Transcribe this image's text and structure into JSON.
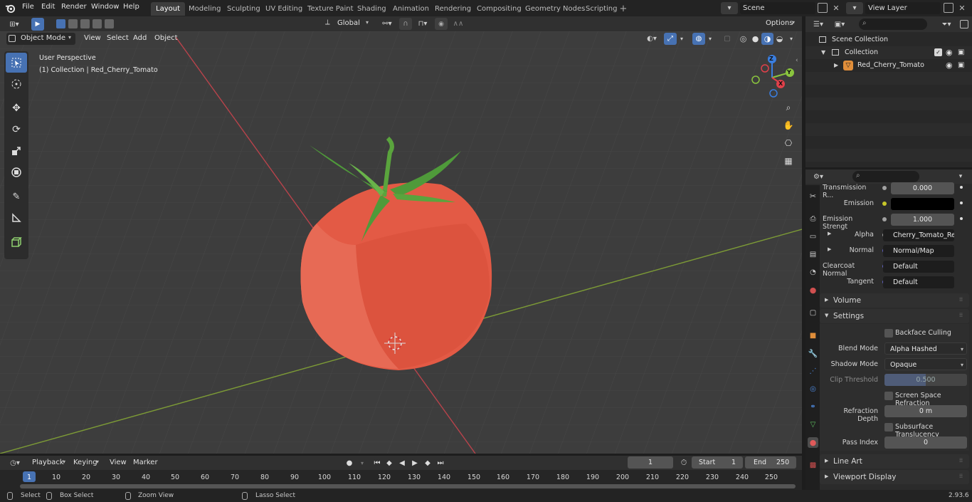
{
  "topbar": {
    "menus": [
      "File",
      "Edit",
      "Render",
      "Window",
      "Help"
    ],
    "workspaces": [
      "Layout",
      "Modeling",
      "Sculpting",
      "UV Editing",
      "Texture Paint",
      "Shading",
      "Animation",
      "Rendering",
      "Compositing",
      "Geometry Nodes",
      "Scripting"
    ],
    "active_workspace": "Layout",
    "scene": "Scene",
    "view_layer": "View Layer"
  },
  "viewport": {
    "transform_orientation": "Global",
    "options": "Options",
    "mode": "Object Mode",
    "menus": [
      "View",
      "Select",
      "Add",
      "Object"
    ],
    "overlay_title": "User Perspective",
    "overlay_collection": "(1) Collection | Red_Cherry_Tomato",
    "gizmo": {
      "z": "Z",
      "y": "Y",
      "x": "X"
    }
  },
  "outliner": {
    "rows": [
      "Scene Collection",
      "Collection",
      "Red_Cherry_Tomato"
    ]
  },
  "properties": {
    "rows": [
      {
        "label": "Transmission R...",
        "value": "0.000"
      },
      {
        "label": "Emission",
        "value": ""
      },
      {
        "label": "Emission Strengt",
        "value": "1.000"
      },
      {
        "label": "Alpha",
        "value": "Cherry_Tomato_Ref..."
      },
      {
        "label": "Normal",
        "value": "Normal/Map"
      },
      {
        "label": "Clearcoat Normal",
        "value": "Default"
      },
      {
        "label": "Tangent",
        "value": "Default"
      }
    ],
    "sections": {
      "volume": "Volume",
      "settings": "Settings",
      "line_art": "Line Art",
      "viewport_display": "Viewport Display"
    },
    "settings": {
      "backface_culling": "Backface Culling",
      "blend_mode_label": "Blend Mode",
      "blend_mode": "Alpha Hashed",
      "shadow_mode_label": "Shadow Mode",
      "shadow_mode": "Opaque",
      "clip_threshold_label": "Clip Threshold",
      "clip_threshold": "0.500",
      "ssr": "Screen Space Refraction",
      "refraction_depth_label": "Refraction Depth",
      "refraction_depth": "0 m",
      "subsurface": "Subsurface Translucency",
      "pass_index_label": "Pass Index",
      "pass_index": "0"
    }
  },
  "timeline": {
    "menus": [
      "Playback",
      "Keying",
      "View",
      "Marker"
    ],
    "current_frame": "1",
    "start_label": "Start",
    "start": "1",
    "end_label": "End",
    "end": "250",
    "ruler": [
      "1",
      "10",
      "20",
      "30",
      "40",
      "50",
      "60",
      "70",
      "80",
      "90",
      "100",
      "110",
      "120",
      "130",
      "140",
      "150",
      "160",
      "170",
      "180",
      "190",
      "200",
      "210",
      "220",
      "230",
      "240",
      "250"
    ]
  },
  "statusbar": {
    "select": "Select",
    "box_select": "Box Select",
    "zoom_view": "Zoom View",
    "lasso_select": "Lasso Select",
    "version": "2.93.6"
  },
  "colors": {
    "accent": "#4772b3",
    "tomato": "#e35a45",
    "stem": "#4f9a3a",
    "x_axis": "#e0404a",
    "y_axis": "#8ac43e",
    "z_axis": "#3a7ee0"
  }
}
